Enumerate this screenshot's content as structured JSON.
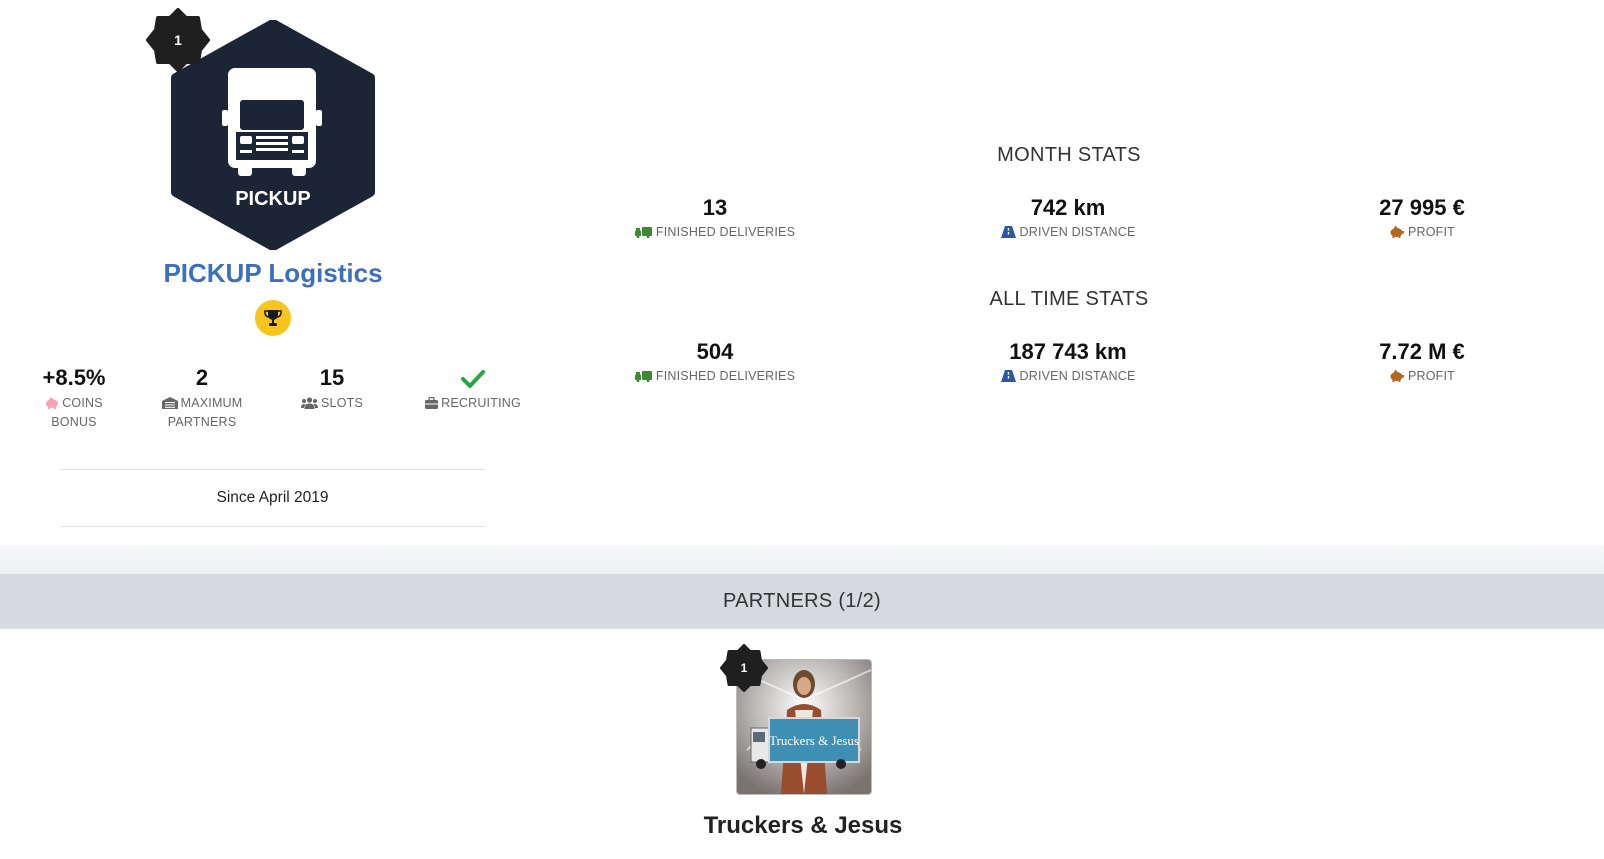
{
  "company": {
    "level": "1",
    "logo_text": "PICKUP",
    "name": "PICKUP Logistics",
    "since": "Since April 2019",
    "stats": [
      {
        "value": "+8.5%",
        "label_line1": "COINS",
        "label_line2": "BONUS",
        "icon": "piggy-bank-icon"
      },
      {
        "value": "2",
        "label_line1": "MAXIMUM",
        "label_line2": "PARTNERS",
        "icon": "warehouse-icon"
      },
      {
        "value": "15",
        "label_line1": "SLOTS",
        "label_line2": "",
        "icon": "users-icon"
      },
      {
        "value": "",
        "label_line1": "RECRUITING",
        "label_line2": "",
        "icon": "briefcase-icon",
        "status_icon": "check-icon",
        "recruiting": true
      }
    ]
  },
  "month_stats": {
    "title": "MONTH STATS",
    "deliveries": {
      "value": "13",
      "label": "FINISHED DELIVERIES"
    },
    "distance": {
      "value": "742 km",
      "label": "DRIVEN DISTANCE"
    },
    "profit": {
      "value": "27 995 €",
      "label": "PROFIT"
    }
  },
  "all_time_stats": {
    "title": "ALL TIME STATS",
    "deliveries": {
      "value": "504",
      "label": "FINISHED DELIVERIES"
    },
    "distance": {
      "value": "187 743 km",
      "label": "DRIVEN DISTANCE"
    },
    "profit": {
      "value": "7.72 M €",
      "label": "PROFIT"
    }
  },
  "partners": {
    "title": "PARTNERS (1/2)",
    "items": [
      {
        "name": "Truckers & Jesus",
        "level": "1",
        "image_text": "Truckers & Jesus"
      }
    ]
  },
  "colors": {
    "accent": "#3a6fc4",
    "logo_bg": "#1b2536",
    "trophy": "#f7c51e",
    "check": "#28a745",
    "delivery_icon": "#3d8b2f",
    "road_icon": "#2c56a8",
    "profit_icon": "#b5651d",
    "piggy_pink": "#f3a5b5"
  }
}
